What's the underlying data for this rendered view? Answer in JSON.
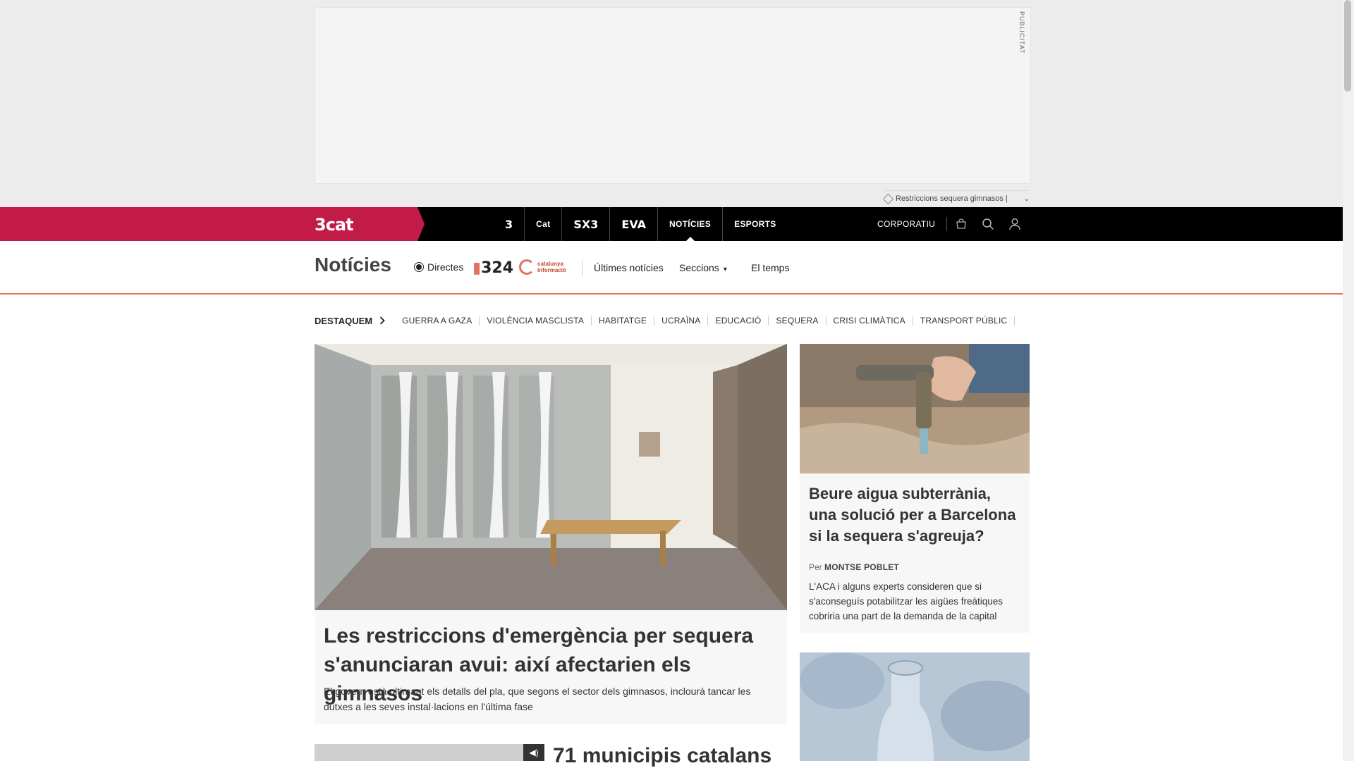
{
  "ad": {
    "label": "PUBLICITAT",
    "tag_text": "Restriccions sequera gimnasos |",
    "tag_chevron": "⌄"
  },
  "topbar": {
    "brand_logo": "3cat",
    "channels": [
      "3",
      "Cat",
      "SX3",
      "EVA",
      "NOTÍCIES",
      "ESPORTS"
    ],
    "active_channel": "NOTÍCIES",
    "corporatiu": "CORPORATIU",
    "icons": [
      "shop-icon",
      "search-icon",
      "user-icon"
    ]
  },
  "section": {
    "title": "Notícies",
    "directes": "Directes",
    "logo_324": "324",
    "logo_catinfo": "catalunya informació",
    "nav": [
      "Últimes notícies",
      "Seccions",
      "El temps"
    ]
  },
  "destaquem": {
    "title": "DESTAQUEM",
    "topics": [
      "GUERRA A GAZA",
      "VIOLÈNCIA MASCLISTA",
      "HABITATGE",
      "UCRAÏNA",
      "EDUCACIÓ",
      "SEQUERA",
      "CRISI CLIMÀTICA",
      "TRANSPORT PÚBLIC"
    ]
  },
  "main_article": {
    "headline": "Les restriccions d'emergència per sequera s'anunciaran avui: així afectarien els gimnasos",
    "summary": "El govern està ultimant els detalls del pla, que segons el sector dels gimnasos, inclourà tancar les dutxes a les seves instal·lacions en l'última fase"
  },
  "second_article": {
    "headline": "71 municipis catalans"
  },
  "side_article": {
    "headline": "Beure aigua subterrània, una solució per a Barcelona si la sequera s'agreuja?",
    "byline_prefix": "Per",
    "author": "MONTSE POBLET",
    "summary": "L'ACA i alguns experts consideren que si s'aconseguís potabilitzar les aigües freàtiques cobriria una part de la demanda de la capital"
  },
  "colors": {
    "brand": "#c21b48",
    "accent": "#e2725b",
    "topbar": "#000000"
  }
}
